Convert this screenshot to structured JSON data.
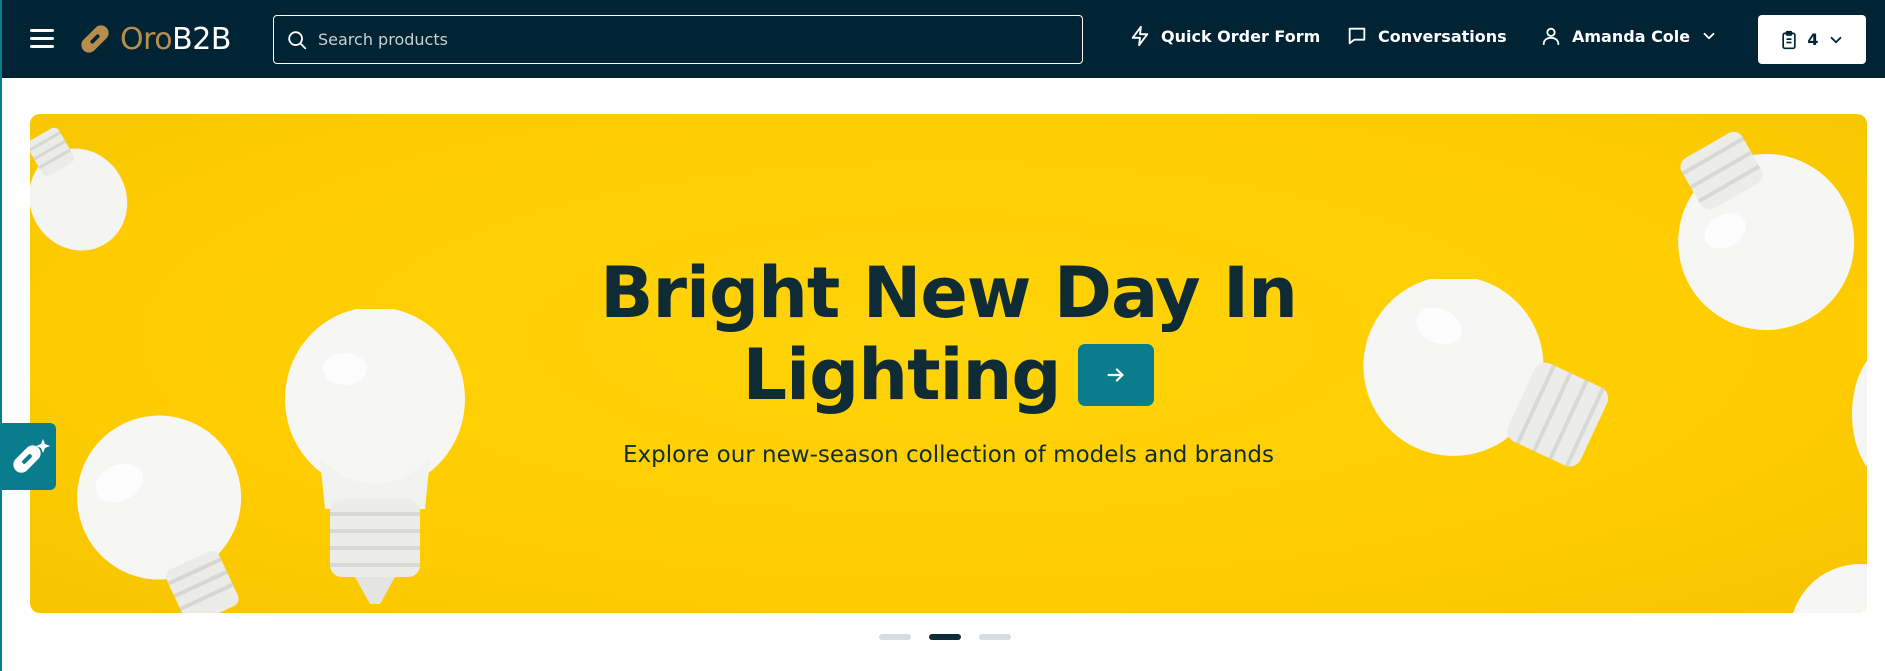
{
  "header": {
    "logo": {
      "prefix": "Oro",
      "suffix": "B2B"
    },
    "search": {
      "placeholder": "Search products",
      "value": ""
    },
    "quick_order_label": "Quick Order Form",
    "conversations_label": "Conversations",
    "user_name": "Amanda Cole",
    "cart_count": "4"
  },
  "hero": {
    "title_line1": "Bright New Day In",
    "title_line2": "Lighting",
    "subtitle": "Explore our new-season collection of models and brands"
  },
  "carousel": {
    "slide_count": 3,
    "active_index": 1
  },
  "colors": {
    "header_bg": "#002434",
    "brand_gold": "#b68d4c",
    "accent_teal": "#0a7d8c",
    "hero_yellow": "#ffcd00",
    "text_dark": "#0e2b36"
  },
  "icons": [
    "menu-icon",
    "logo-mark-icon",
    "search-icon",
    "lightning-icon",
    "chat-bubble-icon",
    "user-icon",
    "chevron-down-icon",
    "clipboard-icon",
    "arrow-right-icon",
    "sparkle-logo-icon"
  ]
}
